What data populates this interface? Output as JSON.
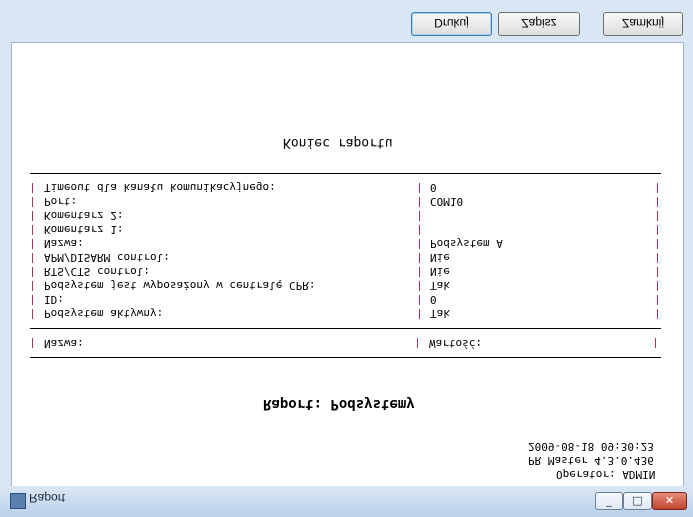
{
  "window": {
    "title": "Raport"
  },
  "toolbar": {
    "print_label": "Drukuj",
    "save_label": "Zapisz",
    "close_label": "Zamknij"
  },
  "report": {
    "end_title": "Koniec raportu",
    "rows": [
      {
        "label": "Timeout dla kanału komunikacyjnego:",
        "value": "0"
      },
      {
        "label": "Port:",
        "value": "COM10"
      },
      {
        "label": "Komentarz 2:",
        "value": ""
      },
      {
        "label": "Komentarz 1:",
        "value": ""
      },
      {
        "label": "Nazwa:",
        "value": "Podsystem A"
      },
      {
        "label": "APM/DISARM control:",
        "value": "Nie"
      },
      {
        "label": "RTS/CTS control:",
        "value": "Nie"
      },
      {
        "label": "Podsystem jest wyposażony w centralę CPR:",
        "value": "Tak"
      },
      {
        "label": "ID:",
        "value": "0"
      },
      {
        "label": "Podsystem aktywny:",
        "value": "Tak"
      }
    ],
    "header": {
      "name_col": "Nazwa:",
      "value_col": "Wartość:"
    },
    "title": "Raport: Podsystemy",
    "meta": {
      "datetime": "2009-08-18 09:30:23",
      "version": "PR Master 4.3.0.436",
      "operator": "Operator: ADMIN"
    }
  }
}
